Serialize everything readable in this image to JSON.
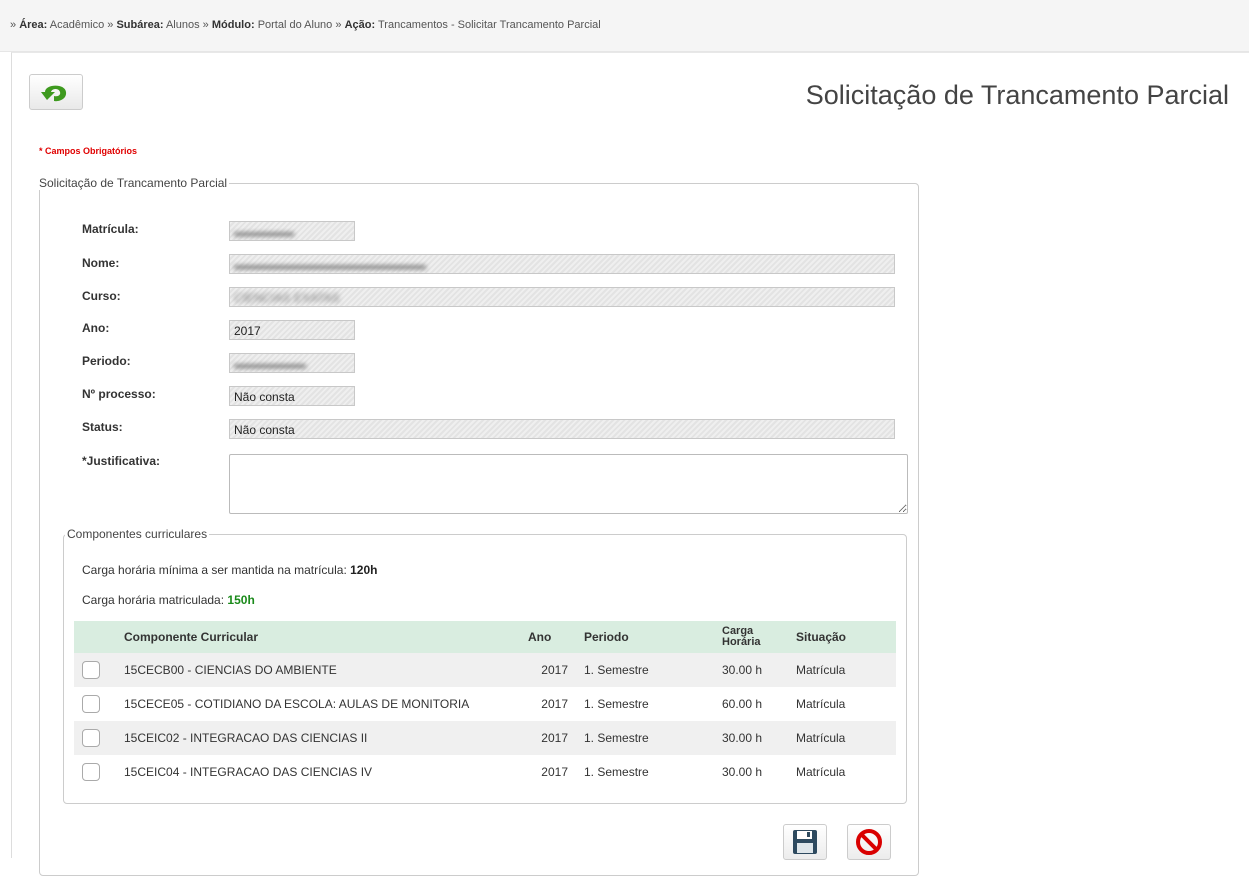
{
  "breadcrumb": {
    "prefix": "»",
    "sep": "»",
    "area_label": "Área:",
    "area_value": "Acadêmico",
    "subarea_label": "Subárea:",
    "subarea_value": "Alunos",
    "modulo_label": "Módulo:",
    "modulo_value": "Portal do Aluno",
    "acao_label": "Ação:",
    "acao_value": "Trancamentos - Solicitar Trancamento Parcial"
  },
  "page": {
    "title": "Solicitação de Trancamento Parcial",
    "required_note": "* Campos Obrigatórios",
    "back_icon": "undo-arrow-icon"
  },
  "form": {
    "legend": "Solicitação de Trancamento Parcial",
    "matricula_label": "Matrícula:",
    "nome_label": "Nome:",
    "curso_label": "Curso:",
    "curso_value_partial": "CIENCIAS EXATAS",
    "ano_label": "Ano:",
    "ano_value": "2017",
    "periodo_label": "Periodo:",
    "processo_label": "Nº processo:",
    "processo_value": "Não consta",
    "status_label": "Status:",
    "status_value": "Não consta",
    "justificativa_label": "*Justificativa:",
    "justificativa_value": ""
  },
  "componentes": {
    "legend": "Componentes curriculares",
    "carga_minima_label": "Carga horária mínima a ser mantida na matrícula:",
    "carga_minima_value": "120h",
    "carga_matriculada_label": "Carga horária matriculada:",
    "carga_matriculada_value": "150h",
    "headers": {
      "componente": "Componente Curricular",
      "ano": "Ano",
      "periodo": "Periodo",
      "carga_line1": "Carga",
      "carga_line2": "Horária",
      "situacao": "Situação"
    },
    "rows": [
      {
        "componente": "15CECB00 - CIENCIAS DO AMBIENTE",
        "ano": "2017",
        "periodo": "1. Semestre",
        "carga": "30.00 h",
        "situacao": "Matrícula"
      },
      {
        "componente": "15CECE05 - COTIDIANO DA ESCOLA: AULAS DE MONITORIA",
        "ano": "2017",
        "periodo": "1. Semestre",
        "carga": "60.00 h",
        "situacao": "Matrícula"
      },
      {
        "componente": "15CEIC02 - INTEGRACAO DAS CIENCIAS II",
        "ano": "2017",
        "periodo": "1. Semestre",
        "carga": "30.00 h",
        "situacao": "Matrícula"
      },
      {
        "componente": "15CEIC04 - INTEGRACAO DAS CIENCIAS IV",
        "ano": "2017",
        "periodo": "1. Semestre",
        "carga": "30.00 h",
        "situacao": "Matrícula"
      }
    ]
  },
  "actions": {
    "save_icon": "floppy-disk-icon",
    "cancel_icon": "prohibited-icon"
  },
  "colors": {
    "title": "#444444",
    "required": "#e00000",
    "table_header": "#d9ede0",
    "green_value": "#1a8a1a",
    "back_arrow": "#3e9a1f",
    "save_icon": "#2e4a5f",
    "cancel_icon": "#d90000"
  }
}
